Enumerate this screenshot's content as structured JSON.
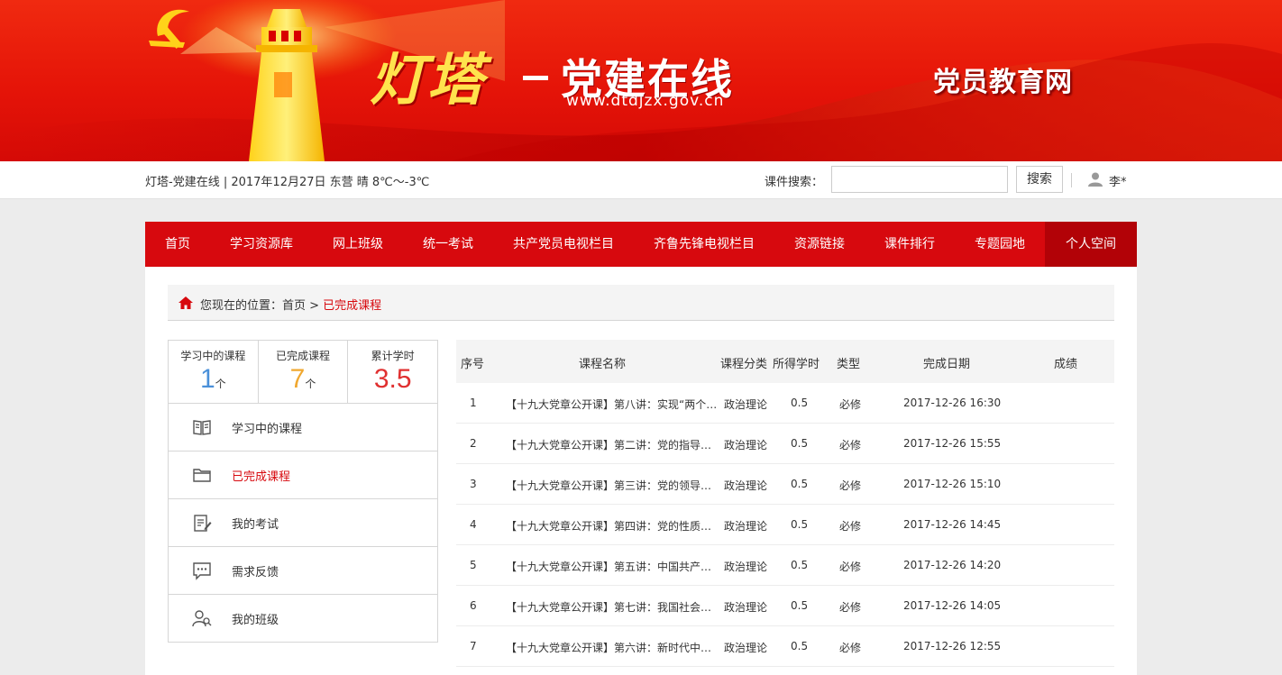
{
  "banner": {
    "title": "灯塔",
    "subtitle": "党建在线",
    "url": "www.dtdjzx.gov.cn",
    "right_title": "党员教育网"
  },
  "infobar": {
    "text": "灯塔-党建在线 | 2017年12月27日 东营 晴 8℃～-3℃",
    "search_label": "课件搜索：",
    "search_value": "",
    "search_button": "搜索",
    "user_name": "李*"
  },
  "nav": {
    "items": [
      {
        "label": "首页"
      },
      {
        "label": "学习资源库"
      },
      {
        "label": "网上班级"
      },
      {
        "label": "统一考试"
      },
      {
        "label": "共产党员电视栏目"
      },
      {
        "label": "齐鲁先锋电视栏目"
      },
      {
        "label": "资源链接"
      },
      {
        "label": "课件排行"
      },
      {
        "label": "专题园地"
      },
      {
        "label": "个人空间"
      }
    ],
    "active_index": 9
  },
  "breadcrumb": {
    "prefix": "您现在的位置：首页 > ",
    "current": "已完成课程"
  },
  "stats": [
    {
      "label": "学习中的课程",
      "value": "1",
      "unit": "个",
      "color": "#4a90d9"
    },
    {
      "label": "已完成课程",
      "value": "7",
      "unit": "个",
      "color": "#f0a830"
    },
    {
      "label": "累计学时",
      "value": "3.5",
      "unit": "",
      "color": "#e03030"
    }
  ],
  "sidebar": {
    "items": [
      {
        "label": "学习中的课程",
        "icon": "book-icon"
      },
      {
        "label": "已完成课程",
        "icon": "folder-icon"
      },
      {
        "label": "我的考试",
        "icon": "exam-icon"
      },
      {
        "label": "需求反馈",
        "icon": "chat-icon"
      },
      {
        "label": "我的班级",
        "icon": "users-icon"
      }
    ],
    "active_index": 1
  },
  "table": {
    "headers": [
      "序号",
      "课程名称",
      "课程分类",
      "所得学时",
      "类型",
      "完成日期",
      "成绩"
    ],
    "rows": [
      {
        "no": "1",
        "name": "【十九大党章公开课】第八讲：实现“两个…",
        "category": "政治理论",
        "hours": "0.5",
        "type": "必修",
        "date": "2017-12-26 16:30",
        "score": ""
      },
      {
        "no": "2",
        "name": "【十九大党章公开课】第二讲：党的指导思…",
        "category": "政治理论",
        "hours": "0.5",
        "type": "必修",
        "date": "2017-12-26 15:55",
        "score": ""
      },
      {
        "no": "3",
        "name": "【十九大党章公开课】第三讲：党的领导、…",
        "category": "政治理论",
        "hours": "0.5",
        "type": "必修",
        "date": "2017-12-26 15:10",
        "score": ""
      },
      {
        "no": "4",
        "name": "【十九大党章公开课】第四讲：党的性质和…",
        "category": "政治理论",
        "hours": "0.5",
        "type": "必修",
        "date": "2017-12-26 14:45",
        "score": ""
      },
      {
        "no": "5",
        "name": "【十九大党章公开课】第五讲：中国共产党…",
        "category": "政治理论",
        "hours": "0.5",
        "type": "必修",
        "date": "2017-12-26 14:20",
        "score": ""
      },
      {
        "no": "6",
        "name": "【十九大党章公开课】第七讲：我国社会主…",
        "category": "政治理论",
        "hours": "0.5",
        "type": "必修",
        "date": "2017-12-26 14:05",
        "score": ""
      },
      {
        "no": "7",
        "name": "【十九大党章公开课】第六讲：新时代中国…",
        "category": "政治理论",
        "hours": "0.5",
        "type": "必修",
        "date": "2017-12-26 12:55",
        "score": ""
      }
    ]
  }
}
